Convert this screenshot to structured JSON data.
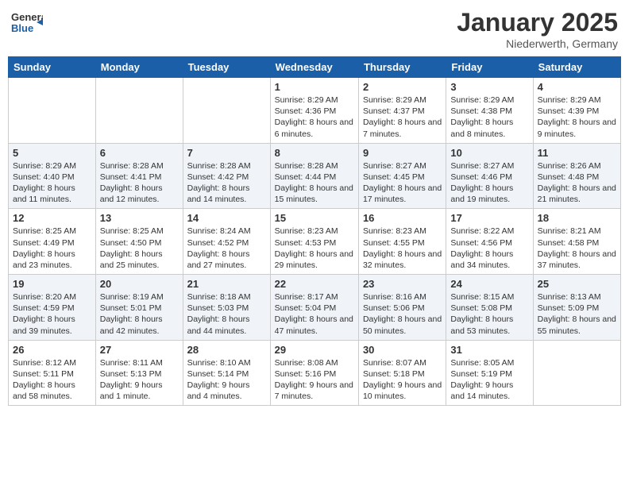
{
  "header": {
    "logo_general": "General",
    "logo_blue": "Blue",
    "month": "January 2025",
    "location": "Niederwerth, Germany"
  },
  "days_of_week": [
    "Sunday",
    "Monday",
    "Tuesday",
    "Wednesday",
    "Thursday",
    "Friday",
    "Saturday"
  ],
  "weeks": [
    [
      {
        "day": "",
        "info": ""
      },
      {
        "day": "",
        "info": ""
      },
      {
        "day": "",
        "info": ""
      },
      {
        "day": "1",
        "info": "Sunrise: 8:29 AM\nSunset: 4:36 PM\nDaylight: 8 hours and 6 minutes."
      },
      {
        "day": "2",
        "info": "Sunrise: 8:29 AM\nSunset: 4:37 PM\nDaylight: 8 hours and 7 minutes."
      },
      {
        "day": "3",
        "info": "Sunrise: 8:29 AM\nSunset: 4:38 PM\nDaylight: 8 hours and 8 minutes."
      },
      {
        "day": "4",
        "info": "Sunrise: 8:29 AM\nSunset: 4:39 PM\nDaylight: 8 hours and 9 minutes."
      }
    ],
    [
      {
        "day": "5",
        "info": "Sunrise: 8:29 AM\nSunset: 4:40 PM\nDaylight: 8 hours and 11 minutes."
      },
      {
        "day": "6",
        "info": "Sunrise: 8:28 AM\nSunset: 4:41 PM\nDaylight: 8 hours and 12 minutes."
      },
      {
        "day": "7",
        "info": "Sunrise: 8:28 AM\nSunset: 4:42 PM\nDaylight: 8 hours and 14 minutes."
      },
      {
        "day": "8",
        "info": "Sunrise: 8:28 AM\nSunset: 4:44 PM\nDaylight: 8 hours and 15 minutes."
      },
      {
        "day": "9",
        "info": "Sunrise: 8:27 AM\nSunset: 4:45 PM\nDaylight: 8 hours and 17 minutes."
      },
      {
        "day": "10",
        "info": "Sunrise: 8:27 AM\nSunset: 4:46 PM\nDaylight: 8 hours and 19 minutes."
      },
      {
        "day": "11",
        "info": "Sunrise: 8:26 AM\nSunset: 4:48 PM\nDaylight: 8 hours and 21 minutes."
      }
    ],
    [
      {
        "day": "12",
        "info": "Sunrise: 8:25 AM\nSunset: 4:49 PM\nDaylight: 8 hours and 23 minutes."
      },
      {
        "day": "13",
        "info": "Sunrise: 8:25 AM\nSunset: 4:50 PM\nDaylight: 8 hours and 25 minutes."
      },
      {
        "day": "14",
        "info": "Sunrise: 8:24 AM\nSunset: 4:52 PM\nDaylight: 8 hours and 27 minutes."
      },
      {
        "day": "15",
        "info": "Sunrise: 8:23 AM\nSunset: 4:53 PM\nDaylight: 8 hours and 29 minutes."
      },
      {
        "day": "16",
        "info": "Sunrise: 8:23 AM\nSunset: 4:55 PM\nDaylight: 8 hours and 32 minutes."
      },
      {
        "day": "17",
        "info": "Sunrise: 8:22 AM\nSunset: 4:56 PM\nDaylight: 8 hours and 34 minutes."
      },
      {
        "day": "18",
        "info": "Sunrise: 8:21 AM\nSunset: 4:58 PM\nDaylight: 8 hours and 37 minutes."
      }
    ],
    [
      {
        "day": "19",
        "info": "Sunrise: 8:20 AM\nSunset: 4:59 PM\nDaylight: 8 hours and 39 minutes."
      },
      {
        "day": "20",
        "info": "Sunrise: 8:19 AM\nSunset: 5:01 PM\nDaylight: 8 hours and 42 minutes."
      },
      {
        "day": "21",
        "info": "Sunrise: 8:18 AM\nSunset: 5:03 PM\nDaylight: 8 hours and 44 minutes."
      },
      {
        "day": "22",
        "info": "Sunrise: 8:17 AM\nSunset: 5:04 PM\nDaylight: 8 hours and 47 minutes."
      },
      {
        "day": "23",
        "info": "Sunrise: 8:16 AM\nSunset: 5:06 PM\nDaylight: 8 hours and 50 minutes."
      },
      {
        "day": "24",
        "info": "Sunrise: 8:15 AM\nSunset: 5:08 PM\nDaylight: 8 hours and 53 minutes."
      },
      {
        "day": "25",
        "info": "Sunrise: 8:13 AM\nSunset: 5:09 PM\nDaylight: 8 hours and 55 minutes."
      }
    ],
    [
      {
        "day": "26",
        "info": "Sunrise: 8:12 AM\nSunset: 5:11 PM\nDaylight: 8 hours and 58 minutes."
      },
      {
        "day": "27",
        "info": "Sunrise: 8:11 AM\nSunset: 5:13 PM\nDaylight: 9 hours and 1 minute."
      },
      {
        "day": "28",
        "info": "Sunrise: 8:10 AM\nSunset: 5:14 PM\nDaylight: 9 hours and 4 minutes."
      },
      {
        "day": "29",
        "info": "Sunrise: 8:08 AM\nSunset: 5:16 PM\nDaylight: 9 hours and 7 minutes."
      },
      {
        "day": "30",
        "info": "Sunrise: 8:07 AM\nSunset: 5:18 PM\nDaylight: 9 hours and 10 minutes."
      },
      {
        "day": "31",
        "info": "Sunrise: 8:05 AM\nSunset: 5:19 PM\nDaylight: 9 hours and 14 minutes."
      },
      {
        "day": "",
        "info": ""
      }
    ]
  ]
}
